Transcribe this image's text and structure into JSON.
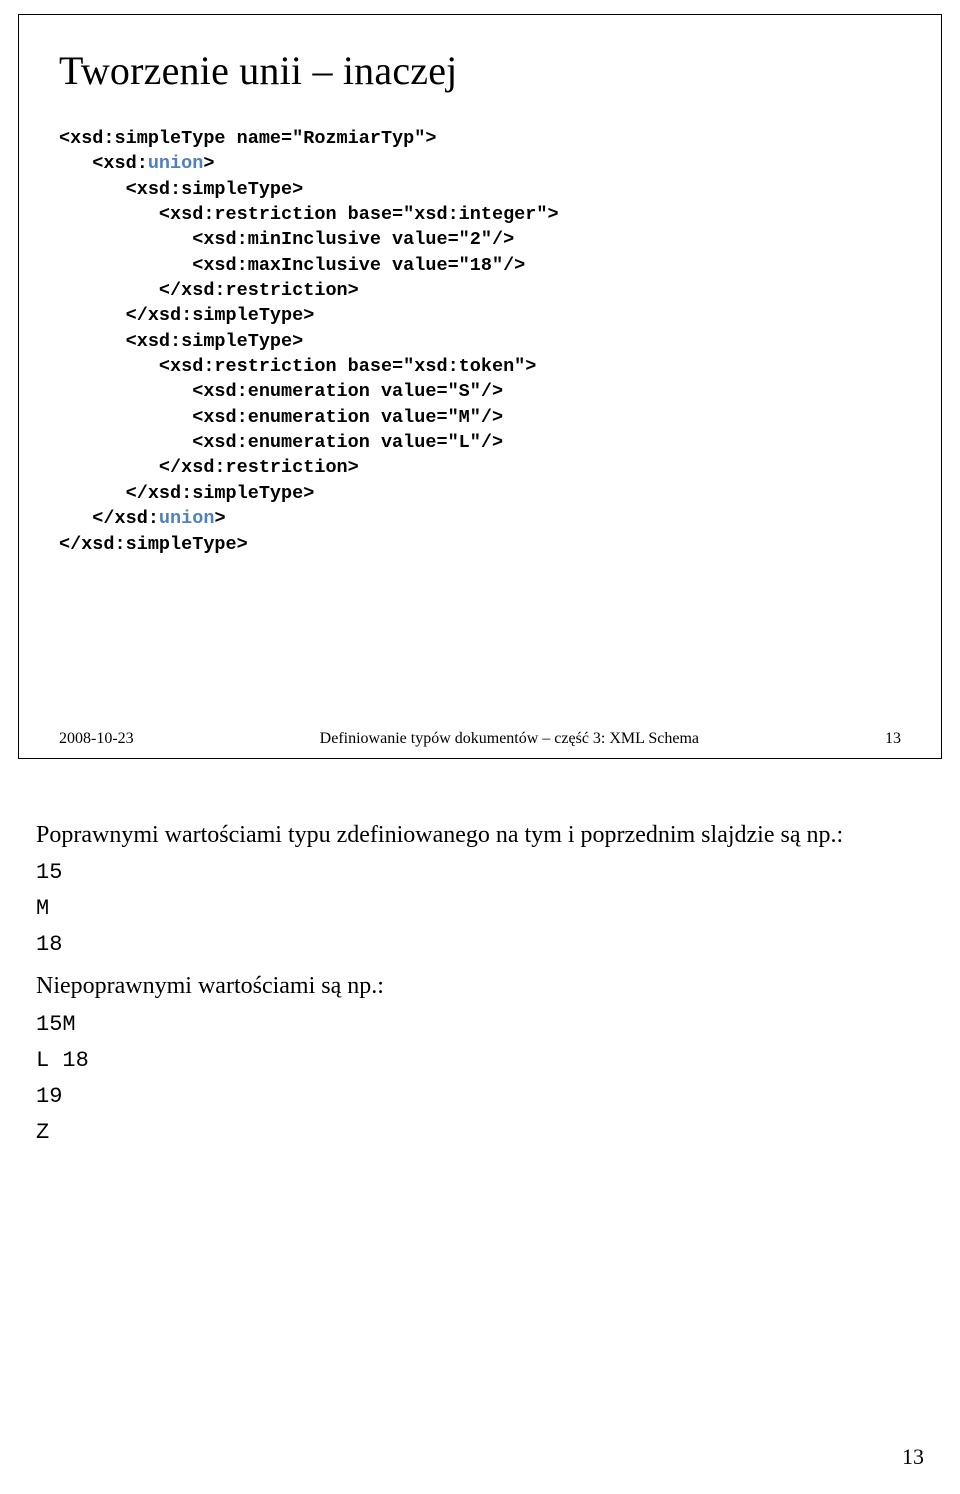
{
  "slide": {
    "title": "Tworzenie unii – inaczej",
    "code": {
      "l1a": "<xsd:simpleType name=\"RozmiarTyp\">",
      "l2a": "   <xsd:",
      "l2b": "union",
      "l2c": ">",
      "l3a": "      <xsd:simpleType>",
      "l4a": "         <xsd:restriction base=\"xsd:integer\">",
      "l5a": "            <xsd:minInclusive value=\"2\"/>",
      "l6a": "            <xsd:maxInclusive value=\"18\"/>",
      "l7a": "         </xsd:restriction>",
      "l8a": "      </xsd:simpleType>",
      "l9a": "      <xsd:simpleType>",
      "l10a": "         <xsd:restriction base=\"xsd:token\">",
      "l11a": "            <xsd:enumeration value=\"S\"/>",
      "l12a": "            <xsd:enumeration value=\"M\"/>",
      "l13a": "            <xsd:enumeration value=\"L\"/>",
      "l14a": "         </xsd:restriction>",
      "l15a": "      </xsd:simpleType>",
      "l16a": "   </xsd:",
      "l16b": "union",
      "l16c": ">",
      "l17a": "</xsd:simpleType>"
    },
    "footer": {
      "date": "2008-10-23",
      "title": "Definiowanie typów dokumentów – część 3: XML Schema",
      "page": "13"
    }
  },
  "notes": {
    "p1": "Poprawnymi wartościami typu zdefiniowanego na tym i poprzednim slajdzie są np.:",
    "valid": [
      "15",
      "M",
      "18"
    ],
    "p2": "Niepoprawnymi wartościami są np.:",
    "invalid": [
      "15M",
      "L 18",
      "19",
      "Z"
    ]
  },
  "pageNumber": "13"
}
